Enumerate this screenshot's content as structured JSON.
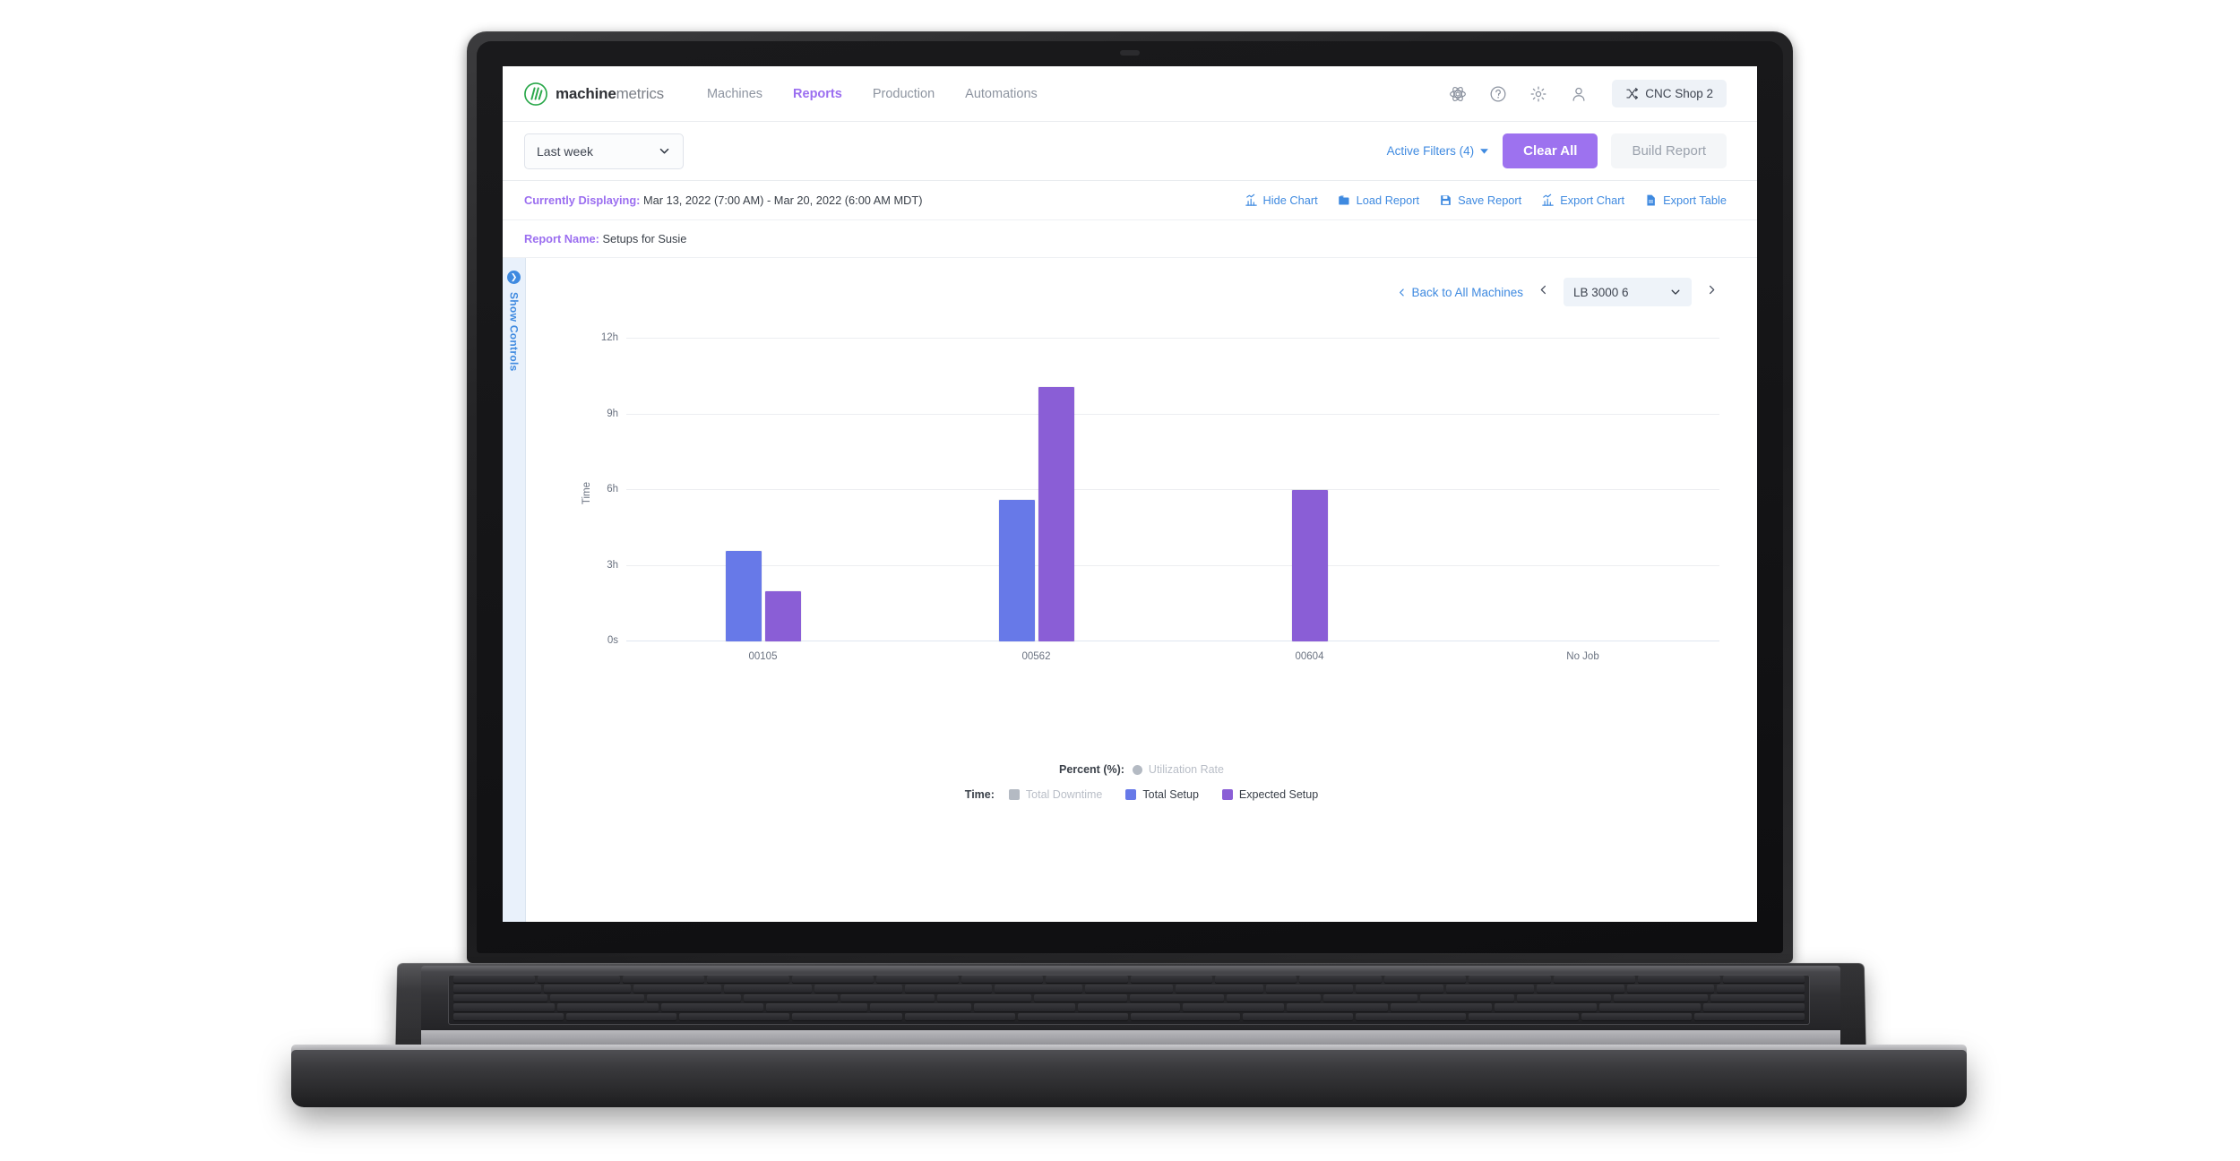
{
  "topnav": {
    "brand_bold": "machine",
    "brand_light": "metrics",
    "brand_logo_icon": "machinemetrics-logo-icon",
    "links": [
      {
        "label": "Machines",
        "active": false
      },
      {
        "label": "Reports",
        "active": true
      },
      {
        "label": "Production",
        "active": false
      },
      {
        "label": "Automations",
        "active": false
      }
    ],
    "icons": [
      "atom-icon",
      "help-circle-icon",
      "gear-icon",
      "user-icon"
    ],
    "shop": {
      "label": "CNC Shop 2",
      "icon": "shuffle-icon"
    }
  },
  "filterbar": {
    "range_value": "Last week",
    "range_icon": "chevron-down-icon",
    "active_filters": "Active Filters (4)",
    "active_filters_icon": "caret-down-icon",
    "clear_all": "Clear All",
    "build_report": "Build Report"
  },
  "display": {
    "label": "Currently Displaying:",
    "value": "Mar 13, 2022 (7:00 AM) - Mar 20, 2022 (6:00 AM MDT)",
    "actions": [
      {
        "label": "Hide Chart",
        "icon": "chart-bars-icon"
      },
      {
        "label": "Load Report",
        "icon": "folder-icon"
      },
      {
        "label": "Save Report",
        "icon": "floppy-disk-icon"
      },
      {
        "label": "Export Chart",
        "icon": "chart-bars-icon"
      },
      {
        "label": "Export Table",
        "icon": "document-icon"
      }
    ]
  },
  "report": {
    "label": "Report Name:",
    "value": "Setups for Susie"
  },
  "controls_rail": {
    "label": "Show Controls",
    "icon": "chevron-right-circle-icon"
  },
  "machine_nav": {
    "back_label": "Back to All Machines",
    "back_icon": "chevron-left-icon",
    "prev_icon": "chevron-left-icon",
    "next_icon": "chevron-right-icon",
    "selected_machine": "LB 3000 6",
    "select_icon": "chevron-down-icon"
  },
  "legend": {
    "percent_title": "Percent (%):",
    "time_title": "Time:",
    "percent_items": [
      {
        "label": "Utilization Rate",
        "color": "#b4bac3",
        "shape": "dot",
        "enabled": false
      }
    ],
    "time_items": [
      {
        "label": "Total Downtime",
        "color": "#b4bac3",
        "shape": "square",
        "enabled": false
      },
      {
        "label": "Total Setup",
        "color": "#6779e8",
        "shape": "square",
        "enabled": true
      },
      {
        "label": "Expected Setup",
        "color": "#8a5ed6",
        "shape": "square",
        "enabled": true
      }
    ]
  },
  "chart_data": {
    "type": "bar",
    "title": "",
    "xlabel": "",
    "ylabel": "Time",
    "categories": [
      "00105",
      "00562",
      "00604",
      "No Job"
    ],
    "ylim": [
      0,
      12
    ],
    "ytick_values": [
      0,
      3,
      6,
      9,
      12
    ],
    "ytick_labels": [
      "0s",
      "3h",
      "6h",
      "9h",
      "12h"
    ],
    "yunit": "hours",
    "grid": true,
    "legend_position": "bottom",
    "series": [
      {
        "name": "Total Downtime",
        "color": "#b4bac3",
        "visible": false,
        "values": [
          null,
          null,
          null,
          null
        ]
      },
      {
        "name": "Total Setup",
        "color": "#6779e8",
        "visible": true,
        "values": [
          3.6,
          5.6,
          null,
          null
        ]
      },
      {
        "name": "Expected Setup",
        "color": "#8a5ed6",
        "visible": true,
        "values": [
          2.0,
          10.1,
          6.0,
          null
        ]
      }
    ]
  },
  "colors": {
    "accent_purple": "#9b6ef0",
    "link_blue": "#3f8ae0",
    "bar_blue": "#6779e8",
    "bar_purple": "#8a5ed6",
    "muted_gray": "#b4bac3"
  }
}
